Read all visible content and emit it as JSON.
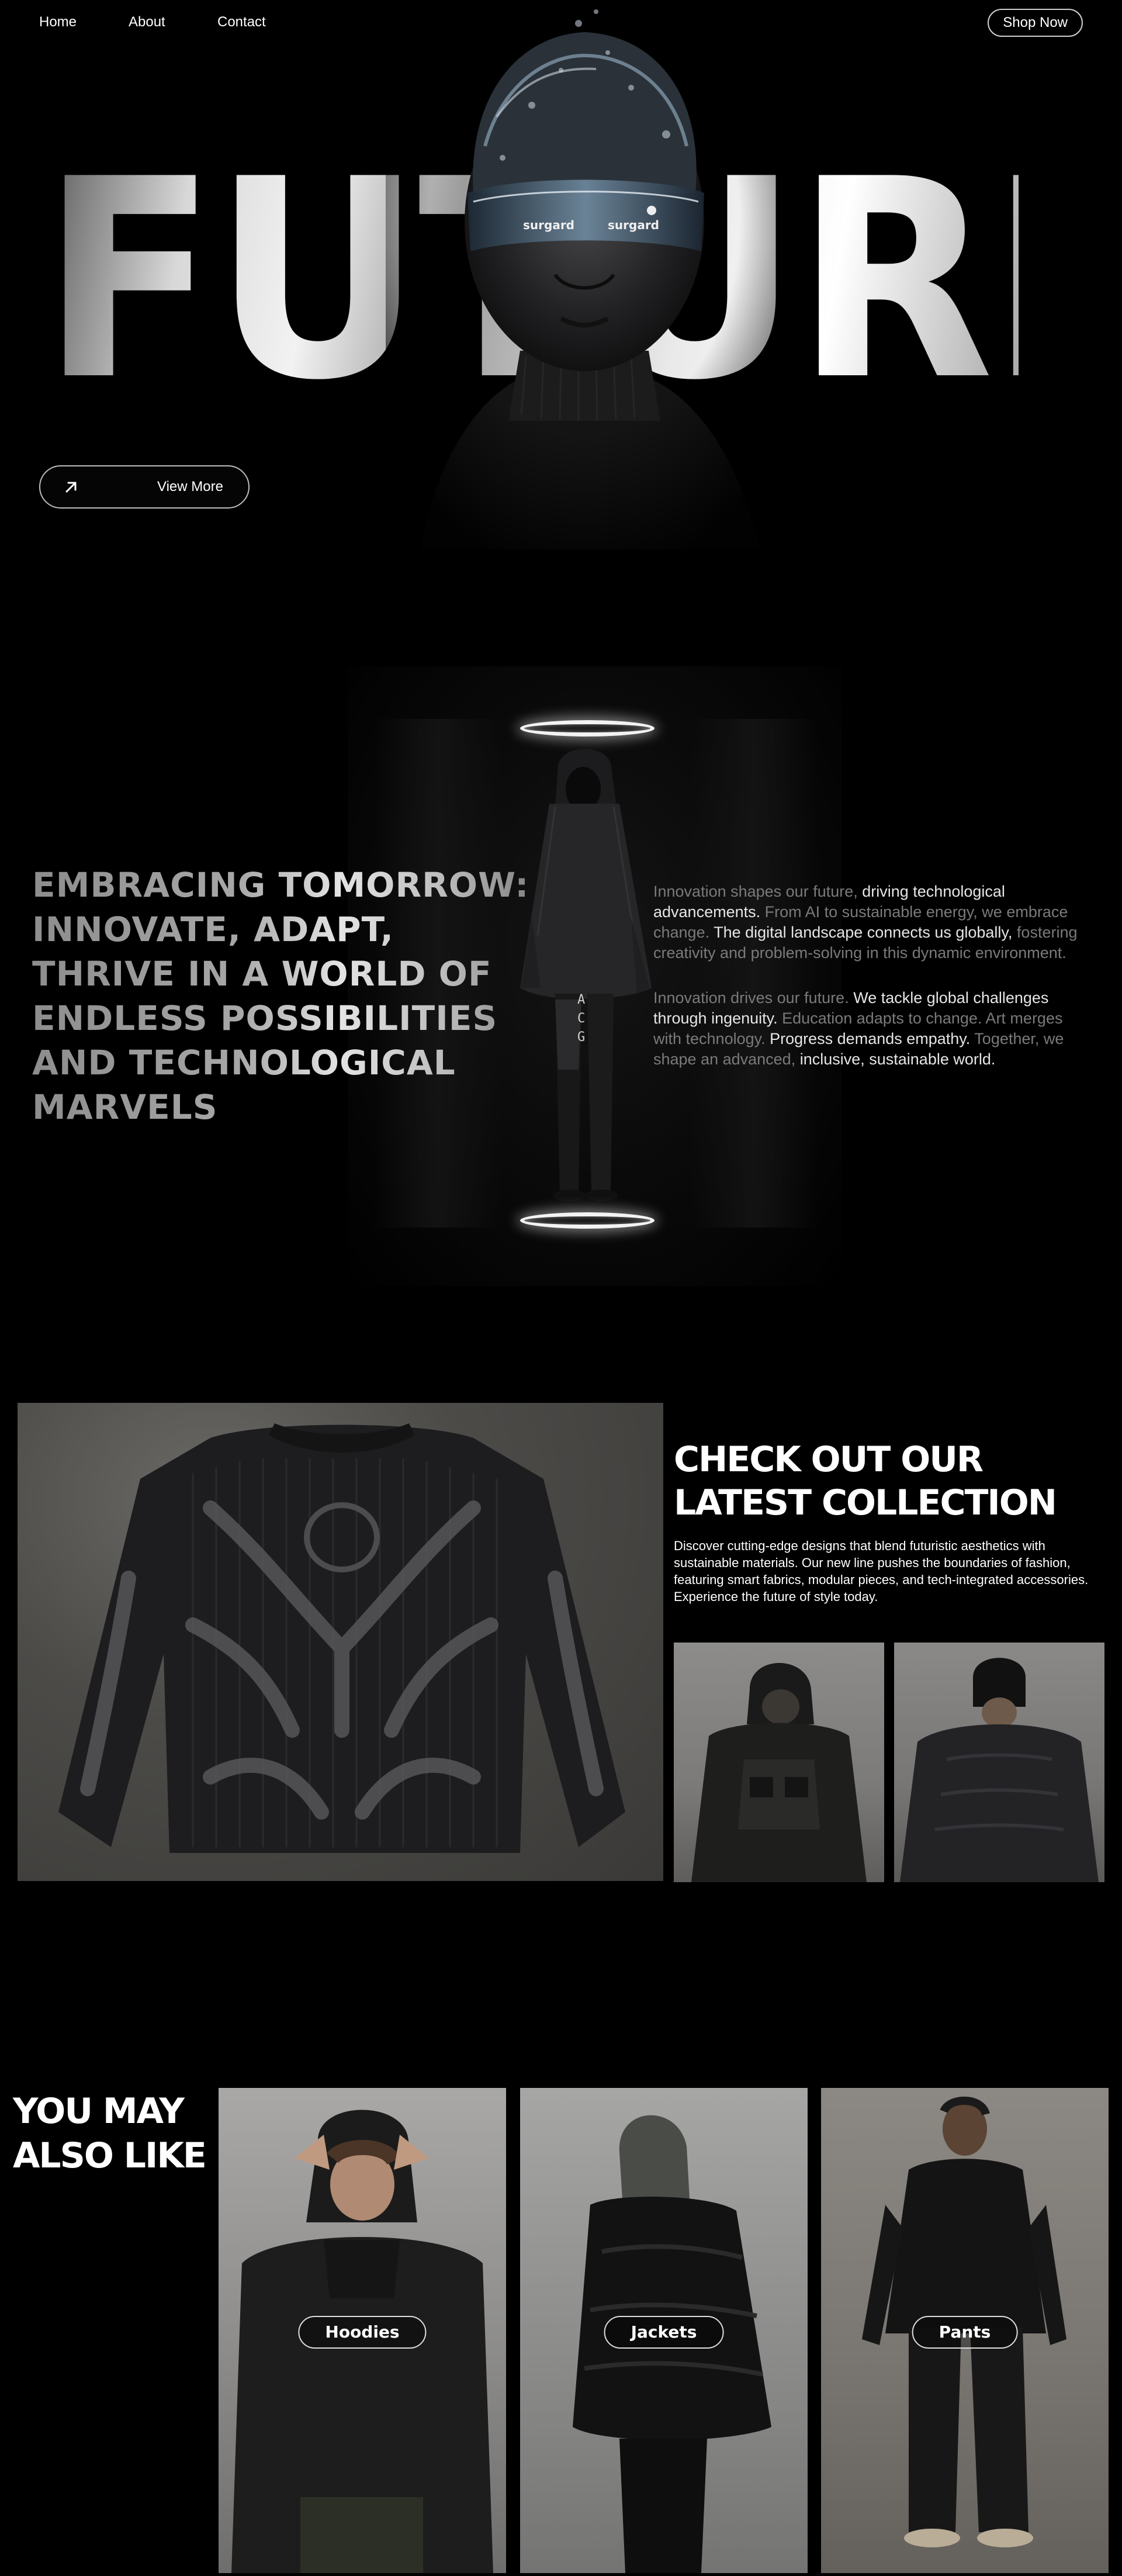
{
  "nav": {
    "links": [
      "Home",
      "About",
      "Contact"
    ],
    "shop_label": "Shop Now"
  },
  "hero": {
    "title": "FUTURE",
    "view_more_label": "View More",
    "headset_brand_left": "surgard",
    "headset_brand_right": "surgard"
  },
  "section2": {
    "heading": "EMBRACING TOMORROW: INNOVATE, ADAPT, THRIVE IN A WORLD OF ENDLESS POSSIBILITIES AND TECHNOLOGICAL MARVELS",
    "para1": {
      "a": "Innovation shapes our future, ",
      "b": "driving technological advancements.",
      "c": " From AI to sustainable energy, ",
      "d": "we embrace change.",
      "e": " The digital landscape connects us globally, ",
      "f": "fostering creativity and problem-solving in this dynamic environment."
    },
    "para2": {
      "a": "Innovation drives our future. ",
      "b": "We tackle global challenges through ingenuity.",
      "c": " Education adapts to change. Art merges with technology. ",
      "d": "Progress demands empathy.",
      "e": " Together, we shape an advanced, ",
      "f": "inclusive, sustainable world."
    },
    "garment_text": "ACG"
  },
  "section3": {
    "title": "CHECK OUT OUR LATEST COLLECTION",
    "description": "Discover cutting-edge designs that blend futuristic aesthetics with sustainable materials. Our new line pushes the boundaries of fashion, featuring smart fabrics, modular pieces, and tech-integrated accessories. Experience the future of style today."
  },
  "section4": {
    "title": "YOU MAY ALSO LIKE",
    "cards": [
      {
        "label": "Hoodies"
      },
      {
        "label": "Jackets"
      },
      {
        "label": "Pants"
      }
    ]
  }
}
